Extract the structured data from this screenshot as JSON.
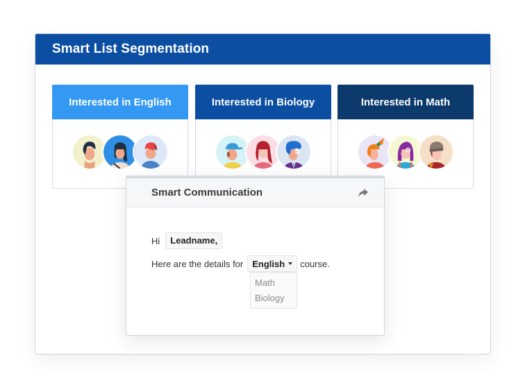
{
  "frame": {
    "title": "Smart List Segmentation",
    "header_color": "#0b4ea2"
  },
  "segments": [
    {
      "label": "Interested in English",
      "color": "#3399f3",
      "avatars": [
        {
          "name": "man-dark-hair",
          "bg": "#f3f0cc"
        },
        {
          "name": "woman-dark-hair",
          "bg": "#2f8fe6"
        },
        {
          "name": "man-red-hair",
          "bg": "#dde8f8"
        }
      ]
    },
    {
      "label": "Interested in Biology",
      "color": "#0b4ea2",
      "avatars": [
        {
          "name": "boy-blue-cap",
          "bg": "#d6f3f8"
        },
        {
          "name": "woman-red-hair",
          "bg": "#fbdde3"
        },
        {
          "name": "man-blue-hair-glasses",
          "bg": "#dbe6f2"
        }
      ]
    },
    {
      "label": "Interested in Math",
      "color": "#0c3a6c",
      "avatars": [
        {
          "name": "girl-orange-ponytail",
          "bg": "#e9e4f6"
        },
        {
          "name": "girl-purple-hair-glasses",
          "bg": "#f6f8d4"
        },
        {
          "name": "man-beanie",
          "bg": "#f5dfc7"
        }
      ]
    }
  ],
  "popup": {
    "title": "Smart Communication",
    "share_icon": "share-icon",
    "greeting": "Hi",
    "lead_token": "Leadname,",
    "details_prefix": "Here are the details for",
    "selected_course": "English",
    "details_suffix": "course.",
    "course_options": [
      "Math",
      "Biology"
    ]
  }
}
